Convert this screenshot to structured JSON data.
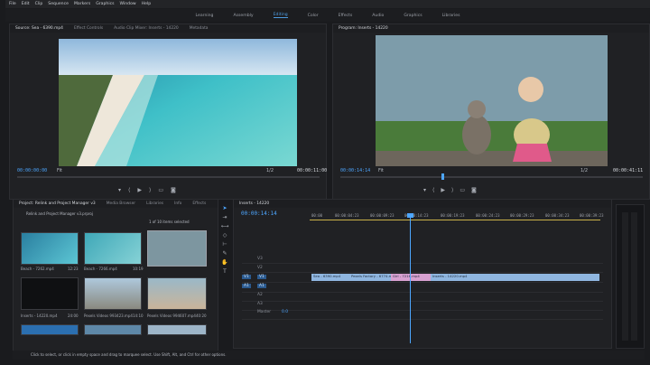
{
  "menu": [
    "File",
    "Edit",
    "Clip",
    "Sequence",
    "Markers",
    "Graphics",
    "Window",
    "Help"
  ],
  "workspaces": [
    "Learning",
    "Assembly",
    "Editing",
    "Color",
    "Effects",
    "Audio",
    "Graphics",
    "Libraries"
  ],
  "workspace_active": "Editing",
  "source_panel": {
    "tabs": [
      "Source: Sea - 6390.mp4",
      "Effect Controls",
      "Audio Clip Mixer: Inserts - 14220",
      "Metadata"
    ],
    "timecode_in": "00:00:00:00",
    "fit": "Fit",
    "ratio": "1/2",
    "timecode_out": "00:00:11:00"
  },
  "program_panel": {
    "title": "Program: Inserts - 14220",
    "timecode_in": "00:00:14:14",
    "fit": "Fit",
    "ratio": "1/2",
    "timecode_out": "00:00:41:11"
  },
  "project_panel": {
    "tabs": [
      "Project: Relink and Project Manager v3",
      "Media Browser",
      "Libraries",
      "Info",
      "Effects"
    ],
    "filename": "Relink and Project Manager v3.prproj",
    "selection": "1 of 10 items selected",
    "items": [
      {
        "name": "Beach - 7262.mp4",
        "dur": "12:23"
      },
      {
        "name": "Beach - 7266.mp4",
        "dur": "10:19"
      },
      {
        "name": "",
        "dur": ""
      },
      {
        "name": "Inserts - 14220.mp4",
        "dur": "24:00"
      },
      {
        "name": "Pexels Videos 993423.mp4",
        "dur": "14:10"
      },
      {
        "name": "Pexels Videos 994607.mp4",
        "dur": "40:20"
      }
    ]
  },
  "timeline": {
    "tab": "Inserts - 14220",
    "timecode": "00:00:14:14",
    "ticks": [
      "00:00",
      "00:00:04:23",
      "00:00:09:23",
      "00:00:14:23",
      "00:00:19:23",
      "00:00:24:23",
      "00:00:29:23",
      "00:00:34:23",
      "00:00:39:23"
    ],
    "tracks": [
      "V3",
      "V2",
      "V1",
      "A1",
      "A2",
      "A3",
      "Master"
    ],
    "master_value": "0.0",
    "clips": [
      "Sea - 6390.mp4",
      "Pexels Factory - 6774.mp4",
      "Girl - 7216.mp4",
      "Inserts - 14220.mp4"
    ]
  },
  "status_text": "Click to select, or click in empty space and drag to marquee select. Use Shift, Alt, and Ctrl for other options.",
  "icons": [
    "play-icon",
    "step-back-icon",
    "step-forward-icon",
    "export-frame-icon",
    "selection-tool-icon",
    "razor-tool-icon",
    "pen-tool-icon",
    "hand-tool-icon",
    "text-tool-icon"
  ],
  "colors": {
    "accent": "#4d9be0",
    "clip_blue": "#8fb6e0",
    "clip_pink": "#d7a0d0",
    "playhead": "#4da6ff"
  }
}
